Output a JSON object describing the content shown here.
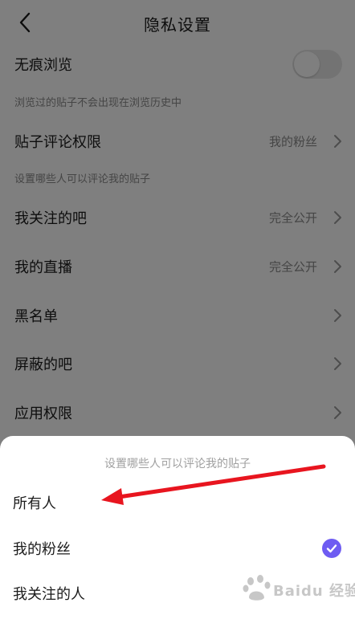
{
  "header": {
    "title": "隐私设置"
  },
  "settings": {
    "incognito": {
      "label": "无痕浏览",
      "hint": "浏览过的贴子不会出现在浏览历史中",
      "enabled": false
    },
    "comment_permission": {
      "label": "贴子评论权限",
      "value": "我的粉丝",
      "hint": "设置哪些人可以评论我的贴子"
    },
    "followed_bars": {
      "label": "我关注的吧",
      "value": "完全公开"
    },
    "my_live": {
      "label": "我的直播",
      "value": "完全公开"
    },
    "blacklist": {
      "label": "黑名单"
    },
    "blocked_bars": {
      "label": "屏蔽的吧"
    },
    "app_permissions": {
      "label": "应用权限"
    }
  },
  "sheet": {
    "title": "设置哪些人可以评论我的贴子",
    "options": [
      {
        "label": "所有人",
        "selected": false
      },
      {
        "label": "我的粉丝",
        "selected": true
      },
      {
        "label": "我关注的人",
        "selected": false
      }
    ]
  },
  "watermark": {
    "text": "Baidu 经验"
  },
  "colors": {
    "accent": "#6e5cf2",
    "annotation_arrow": "#e8151f",
    "secondary_text": "#8a8a8a"
  },
  "icons": {
    "back": "chevron-left-icon",
    "row_arrow": "chevron-right-icon",
    "selected": "checkmark-icon"
  }
}
